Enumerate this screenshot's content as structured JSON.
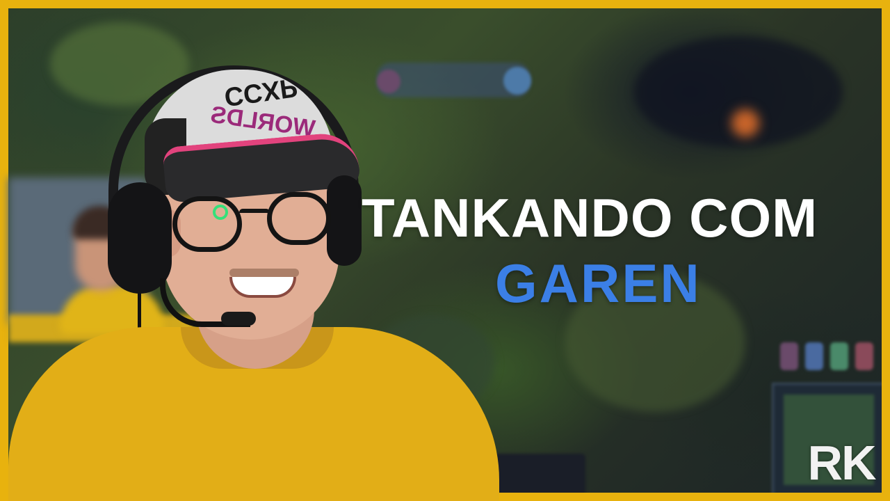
{
  "thumbnail": {
    "title_line1": "TANKANDO COM",
    "title_line2": "GAREN",
    "title_line1_color": "#ffffff",
    "title_line2_color": "#3b7fe6",
    "frame_color": "#e8b20e",
    "watermark": "RK",
    "cap_text_top": "CCXP",
    "cap_text_bottom": "WORLDS"
  }
}
